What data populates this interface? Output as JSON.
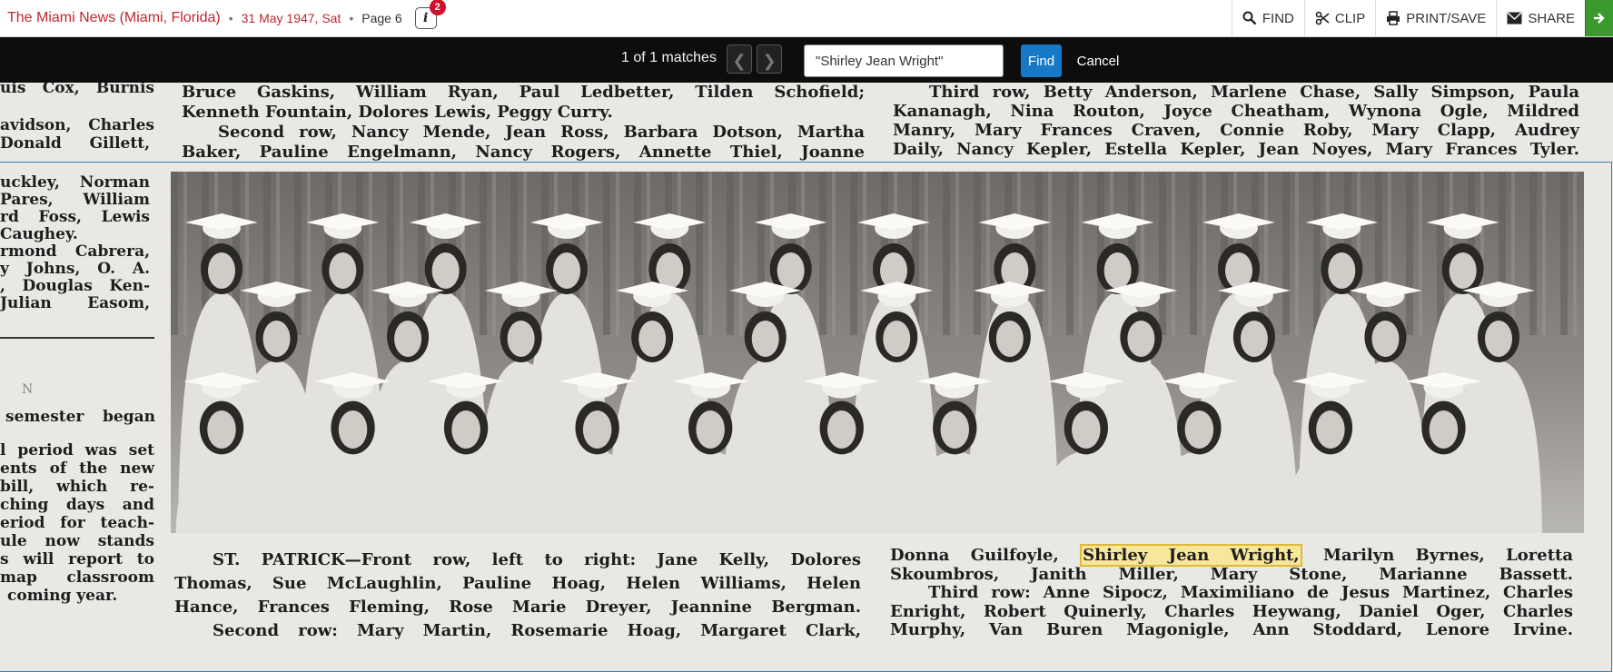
{
  "header": {
    "publication": "The Miami News (Miami, Florida)",
    "date": "31 May 1947, Sat",
    "page": "Page 6",
    "info_label": "i",
    "info_badge": "2",
    "tools": {
      "find": "FIND",
      "clip": "CLIP",
      "print_save": "PRINT/SAVE",
      "share": "SHARE"
    }
  },
  "findbar": {
    "matches": "1 of 1 matches",
    "prev_glyph": "❮",
    "next_glyph": "❯",
    "query": "\"Shirley Jean Wright\"",
    "find_label": "Find",
    "cancel_label": "Cancel"
  },
  "article": {
    "left_column": [
      "uis Cox, Burnis",
      "avidson, Charles",
      "Donald Gillett,",
      "uckley, Norman",
      "Pares, William",
      "rd Foss, Lewis",
      "Caughey.",
      "rmond Cabrera,",
      "y Johns, O. A.",
      ", Douglas Ken-",
      "Julian Easom,",
      "N",
      "semester began",
      "l period was set",
      "ents of the new",
      "bill, which re-",
      "ching days and",
      "eriod for teach-",
      "ule now stands",
      "s will report to",
      "map classroom",
      "coming year."
    ],
    "top_middle": [
      "Bruce Gaskins, William Ryan, Paul Ledbetter, Tilden Schofield;",
      "Kenneth Fountain, Dolores Lewis, Peggy Curry.",
      "Second row, Nancy Mende, Jean Ross, Barbara Dotson, Martha",
      "Baker, Pauline Engelmann, Nancy Rogers, Annette Thiel, Joanne"
    ],
    "top_right": [
      "Third row, Betty Anderson, Marlene Chase, Sally Simpson, Paula",
      "Kananagh, Nina Routon, Joyce Cheatham, Wynona Ogle, Mildred",
      "Manry, Mary Frances Craven, Connie Roby, Mary Clapp, Audrey",
      "Daily, Nancy Kepler, Estella Kepler, Jean Noyes, Mary Frances Tyler."
    ],
    "caption_left": {
      "lead": "ST. PATRICK",
      "line1": "—Front row, left to right: Jane Kelly, Dolores",
      "line2": "Thomas, Sue McLaughlin, Pauline Hoag, Helen Williams, Helen",
      "line3": "Hance, Frances Fleming, Rose Marie Dreyer, Jeannine Bergman.",
      "line4": "Second row: Mary Martin, Rosemarie Hoag, Margaret Clark,"
    },
    "caption_right": {
      "line1_before": "Donna Guilfoyle,",
      "highlight": "Shirley Jean Wright,",
      "line1_after": "Marilyn Byrnes, Loretta",
      "line2": "Skoumbros, Janith Miller, Mary Stone, Marianne Bassett.",
      "line3": "Third row: Anne Sipocz, Maximiliano de Jesus Martinez, Charles",
      "line4": "Enright, Robert Quinerly, Charles Heywang, Daniel Oger, Charles",
      "line5": "Murphy, Van Buren Magonigle, Ann Stoddard, Lenore Irvine."
    }
  },
  "colors": {
    "publication_red": "#c0272d",
    "findbar_bg": "#0d0d0d",
    "find_button_blue": "#1679c8",
    "highlight_fill": "#f6e79a",
    "clip_frame_blue": "#3d7fbe",
    "share_button_green": "#3a9a2e"
  },
  "icons": [
    "search-icon",
    "scissors-icon",
    "printer-icon",
    "envelope-icon",
    "arrow-right-icon",
    "info-icon"
  ]
}
